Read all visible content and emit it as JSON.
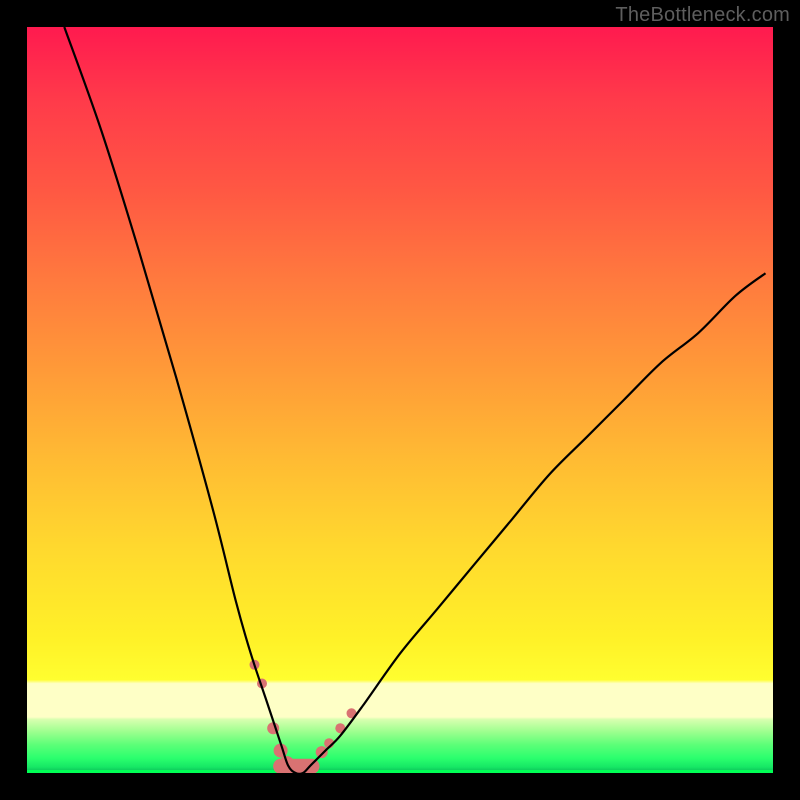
{
  "watermark": {
    "text": "TheBottleneck.com"
  },
  "colors": {
    "frame": "#000000",
    "curve": "#000000",
    "marker": "#d97272",
    "gradient_stops": [
      "#ff1a4f",
      "#ff3b4a",
      "#ff5843",
      "#ff7a3e",
      "#ff9a38",
      "#ffbb33",
      "#ffd92e",
      "#fff128",
      "#fffe2f",
      "#feffc6",
      "#d9ffb0",
      "#9cff8e",
      "#5cff78",
      "#2bff6e",
      "#16e765",
      "#0fcf5c",
      "#00ff55"
    ]
  },
  "chart_data": {
    "type": "line",
    "title": "",
    "xlabel": "",
    "ylabel": "",
    "xlim": [
      0,
      100
    ],
    "ylim": [
      0,
      100
    ],
    "note": "Curve is a V-shaped bottleneck function. y≈0 (green zone) near x≈36; rises steeply on both sides. Background color encodes y (red≈high bottleneck, green≈low). Values below are (x, y_percent) samples read from the plot; y=0 at curve bottom, y=100 at top edge.",
    "series": [
      {
        "name": "bottleneck-curve",
        "x": [
          5,
          10,
          15,
          20,
          25,
          28,
          30,
          32,
          34,
          35,
          36,
          37,
          38,
          40,
          42,
          45,
          50,
          55,
          60,
          65,
          70,
          75,
          80,
          85,
          90,
          95,
          99
        ],
        "values": [
          100,
          86,
          70,
          53,
          35,
          23,
          16,
          10,
          4,
          1,
          0,
          0,
          1,
          3,
          5,
          9,
          16,
          22,
          28,
          34,
          40,
          45,
          50,
          55,
          59,
          64,
          67
        ]
      }
    ],
    "markers": {
      "name": "highlighted-points",
      "note": "Salmon dots/segments near valley on both flanks and along the flat bottom.",
      "x": [
        30.5,
        31.5,
        33.0,
        34.0,
        34.8,
        35.5,
        36.2,
        37.0,
        37.8,
        39.5,
        40.5,
        42.0,
        43.5
      ],
      "values": [
        14.5,
        12.0,
        6.0,
        3.0,
        1.2,
        0.4,
        0.2,
        0.3,
        0.6,
        2.8,
        4.0,
        6.0,
        8.0
      ],
      "radius": [
        5,
        5,
        6,
        7,
        8,
        8,
        8,
        8,
        8,
        6,
        5,
        5,
        5
      ]
    }
  }
}
